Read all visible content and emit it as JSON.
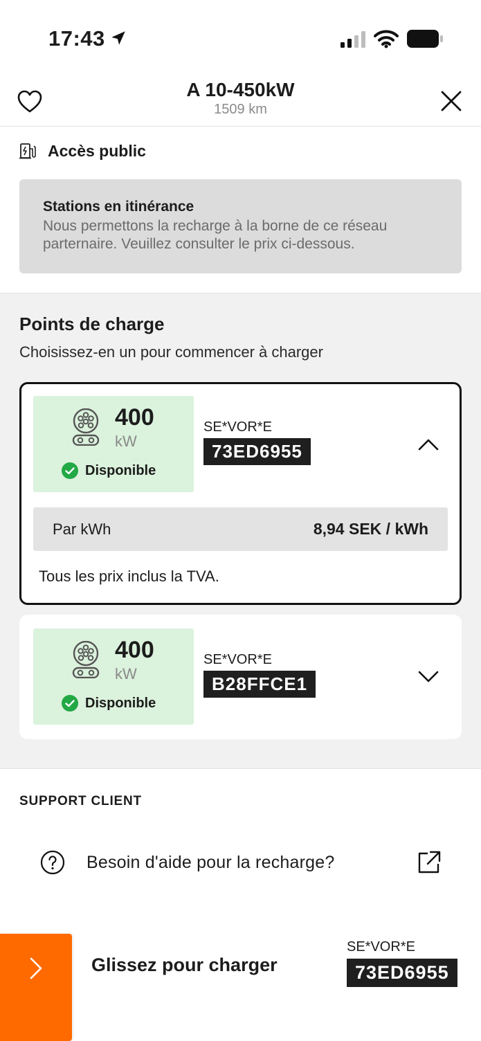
{
  "status_bar": {
    "time": "17:43",
    "icons": [
      "location-arrow-icon",
      "signal-icon",
      "wifi-icon",
      "battery-icon"
    ]
  },
  "header": {
    "title": "A 10-450kW",
    "distance": "1509 km",
    "icons": [
      "heart-icon",
      "close-icon"
    ]
  },
  "access": {
    "icon": "charging-station-icon",
    "label": "Accès public"
  },
  "roaming": {
    "title": "Stations en itinérance",
    "description": "Nous permettons la recharge à la borne de ce réseau parternaire. Veuillez consulter le prix ci-dessous."
  },
  "points": {
    "title": "Points de charge",
    "subtitle": "Choisissez-en un pour commencer à charger",
    "items": [
      {
        "power": "400",
        "unit": "kW",
        "status": "Disponible",
        "operator": "SE*VOR*E",
        "id": "73ED6955",
        "expanded": true,
        "price_label": "Par kWh",
        "price_value": "8,94 SEK / kWh",
        "vat_note": "Tous les prix inclus la TVA."
      },
      {
        "power": "400",
        "unit": "kW",
        "status": "Disponible",
        "operator": "SE*VOR*E",
        "id": "B28FFCE1",
        "expanded": false
      }
    ]
  },
  "support": {
    "title": "SUPPORT CLIENT",
    "items": [
      {
        "label": "Besoin d'aide pour la recharge?"
      }
    ]
  },
  "bottom": {
    "swipe_label": "Glissez pour charger",
    "operator": "SE*VOR*E",
    "id": "73ED6955"
  },
  "colors": {
    "accent": "#ff6a00",
    "available_bg": "#dbf2dc",
    "available_check": "#22a845",
    "roaming_bg": "#dcdcdc",
    "section_bg": "#f1f1f1"
  }
}
